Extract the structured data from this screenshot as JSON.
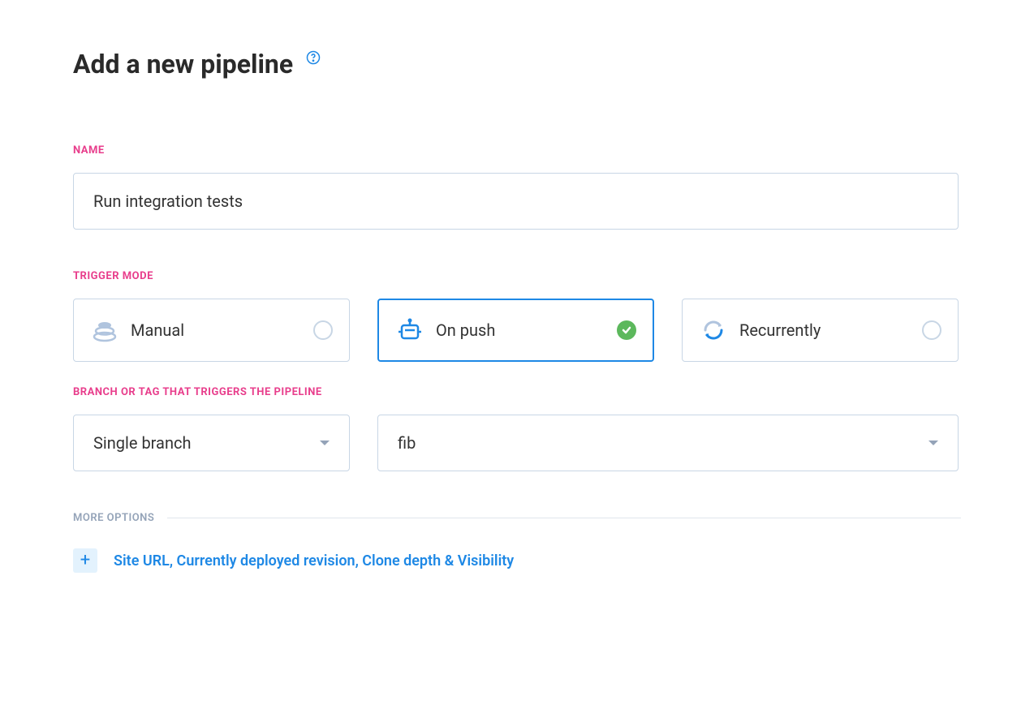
{
  "header": {
    "title": "Add a new pipeline"
  },
  "form": {
    "name": {
      "label": "NAME",
      "value": "Run integration tests"
    },
    "triggerMode": {
      "label": "TRIGGER MODE",
      "options": [
        {
          "label": "Manual",
          "icon": "manual-icon",
          "selected": false
        },
        {
          "label": "On push",
          "icon": "robot-icon",
          "selected": true
        },
        {
          "label": "Recurrently",
          "icon": "cycle-icon",
          "selected": false
        }
      ]
    },
    "branchTrigger": {
      "label": "BRANCH OR TAG THAT TRIGGERS THE PIPELINE",
      "typeSelect": "Single branch",
      "branchSelect": "fib"
    },
    "moreOptions": {
      "label": "MORE OPTIONS",
      "expandText": "Site URL, Currently deployed revision, Clone depth & Visibility"
    }
  },
  "colors": {
    "accent": "#1e88e5",
    "labelPink": "#e83e8c",
    "success": "#5cb85c",
    "border": "#c8d6e5"
  }
}
